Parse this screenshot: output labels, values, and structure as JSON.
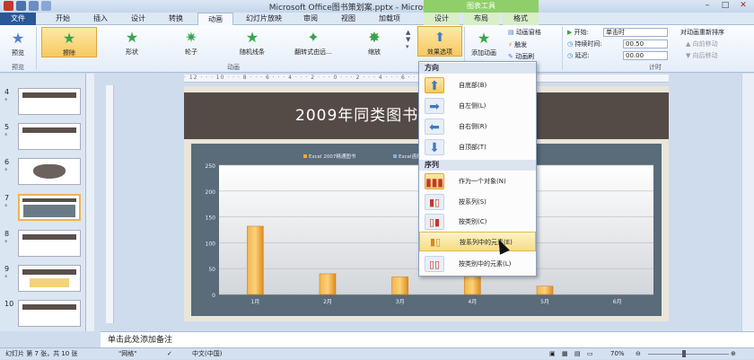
{
  "window": {
    "title": "Microsoft Office图书策划案.pptx - Microsoft PowerPoint",
    "context_tools": "图表工具",
    "min": "–",
    "max": "□",
    "close": "✕"
  },
  "tabs": [
    "文件",
    "开始",
    "插入",
    "设计",
    "转换",
    "动画",
    "幻灯片放映",
    "审阅",
    "视图",
    "加载项",
    "设计",
    "布局",
    "格式"
  ],
  "ribbon": {
    "preview_label": "预览",
    "preview_group": "预览",
    "effects": [
      "擦除",
      "形状",
      "轮子",
      "随机线条",
      "翻转式由远...",
      "缩放"
    ],
    "animation_group": "动画",
    "effect_options": "效果选项",
    "add_animation": "添加动画",
    "animation_pane": "动画窗格",
    "trigger": "触发",
    "animation_painter": "动画刷",
    "start_label": "开始:",
    "start_value": "单击时",
    "duration_label": "持续时间:",
    "duration_value": "00.50",
    "delay_label": "延迟:",
    "delay_value": "00.00",
    "timing_group": "计时",
    "reorder_label": "对动画重新排序",
    "move_earlier": "向前移动",
    "move_later": "向后移动"
  },
  "thumbnails": [
    {
      "num": "4",
      "mark": "*"
    },
    {
      "num": "5",
      "mark": "*"
    },
    {
      "num": "6",
      "mark": "*"
    },
    {
      "num": "7",
      "mark": "*"
    },
    {
      "num": "8",
      "mark": "*"
    },
    {
      "num": "9",
      "mark": "*"
    },
    {
      "num": "10",
      "mark": ""
    }
  ],
  "slide": {
    "title": "2009年同类图书销售统计"
  },
  "chart_data": {
    "type": "bar",
    "categories": [
      "1月",
      "2月",
      "3月",
      "4月",
      "5月",
      "6月"
    ],
    "values": [
      132,
      40,
      34,
      48,
      16,
      0
    ],
    "ylim": [
      0,
      250
    ],
    "yticks": [
      "250",
      "200",
      "150",
      "100",
      "50",
      "0"
    ],
    "legend": [
      "Excel 2007精通图书",
      "Excel函数应用",
      "Excel应用"
    ]
  },
  "menu": {
    "direction_header": "方向",
    "directions": [
      "自底部(B)",
      "自左侧(L)",
      "自右侧(R)",
      "自顶部(T)"
    ],
    "sequence_header": "序列",
    "sequences": [
      "作为一个对象(N)",
      "按系列(S)",
      "按类别(C)",
      "按系列中的元素(E)",
      "按类别中的元素(L)"
    ]
  },
  "notes_placeholder": "单击此处添加备注",
  "status": {
    "slide_info": "幻灯片 第 7 张，共 10 张",
    "theme": "\"网格\"",
    "language": "中文(中国)",
    "zoom": "70%"
  }
}
